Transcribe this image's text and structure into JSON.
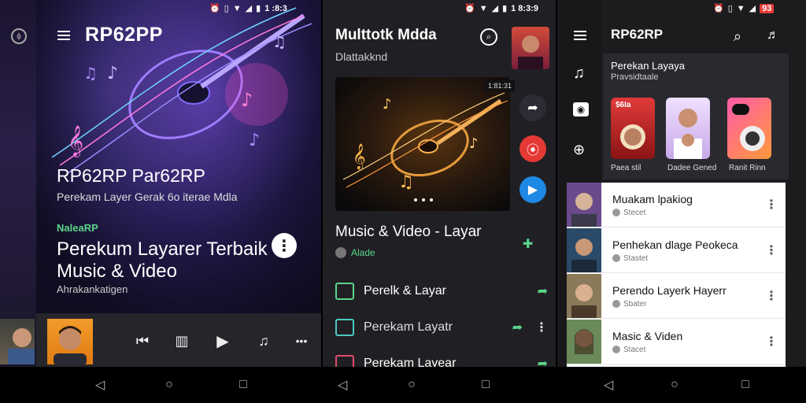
{
  "status": {
    "panel1_time": "1 :8:3",
    "panel2_time": "1 8:3:9",
    "panel3_time": "93"
  },
  "panel1": {
    "app_title": "RP62PP",
    "hero_line1": "RP62RP Par62RP",
    "hero_line2": "Perekam Layer Gerak 6o iterae Mdla",
    "tag": "NaleaRP",
    "headline": "Perekum Layarer Terbaik Music & Video",
    "caption": "Ahrakankatigen",
    "more_icon": "more-vertical-icon"
  },
  "panel2": {
    "title": "Multtotk Mdda",
    "subtitle": "Dlattakknd",
    "art_badge": "1:81:31",
    "section_title": "Music & Video - Layar",
    "chip": "Alade",
    "list": [
      {
        "label": "Perelk & Layar"
      },
      {
        "label": "Perekam Layatr"
      },
      {
        "label": "Perekam Layear"
      }
    ]
  },
  "panel3": {
    "app_title": "RP62RP",
    "card_title": "Perekan Layaya",
    "card_subtitle": "Pravsidtaale",
    "tiles": [
      {
        "label": "Paea stil"
      },
      {
        "label": "Dadee Gened"
      },
      {
        "label": "Ranit Rinn"
      }
    ],
    "tile1_badge": "$6Ia",
    "rows": [
      {
        "title": "Muakam lpakiog",
        "sub": "Stecet"
      },
      {
        "title": "Penhekan dlage Peokeca",
        "sub": "Stastet"
      },
      {
        "title": "Perendo Layerk Hayerr",
        "sub": "Sbater"
      },
      {
        "title": "Masic & Viden",
        "sub": "Stacet"
      }
    ]
  },
  "colors": {
    "accent_green": "#5bd58b",
    "fab_red": "#e53935",
    "fab_blue": "#1e88e5",
    "panel_bg": "#202024"
  }
}
